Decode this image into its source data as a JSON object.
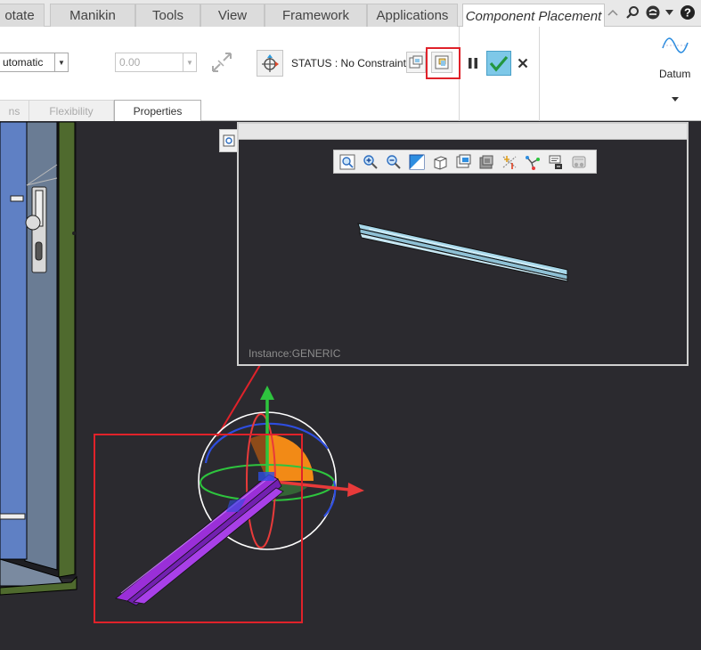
{
  "menu": {
    "tabs": [
      {
        "label": "otate"
      },
      {
        "label": "Manikin"
      },
      {
        "label": "Tools"
      },
      {
        "label": "View"
      },
      {
        "label": "Framework"
      },
      {
        "label": "Applications"
      },
      {
        "label": "Component Placement",
        "active": true
      }
    ]
  },
  "ribbon": {
    "constraint_type_value": "utomatic",
    "offset_value": "0.00",
    "status_text": "STATUS : No Constraints",
    "datum_label": "Datum",
    "subtabs": [
      {
        "label": "ns"
      },
      {
        "label": "Flexibility"
      },
      {
        "label": "Properties",
        "active": true
      }
    ]
  },
  "preview": {
    "instance_label": "Instance:GENERIC"
  },
  "colors": {
    "highlight": "#e0222a",
    "apply": "#32a852",
    "apply_bg": "#7ec8e8",
    "part_purple": "#9a2fd8",
    "drag_x": "#e83a3a",
    "drag_y": "#2ec43e",
    "drag_z": "#2e4ee0"
  },
  "icons": [
    "minimize-icon",
    "search-icon",
    "help-menu-icon",
    "help-icon",
    "drag-dropdown-icon",
    "flip-icon",
    "dragger-icon",
    "separate-window-icon",
    "component-window-icon",
    "pause-icon",
    "apply-icon",
    "cancel-icon",
    "datum-icon"
  ]
}
